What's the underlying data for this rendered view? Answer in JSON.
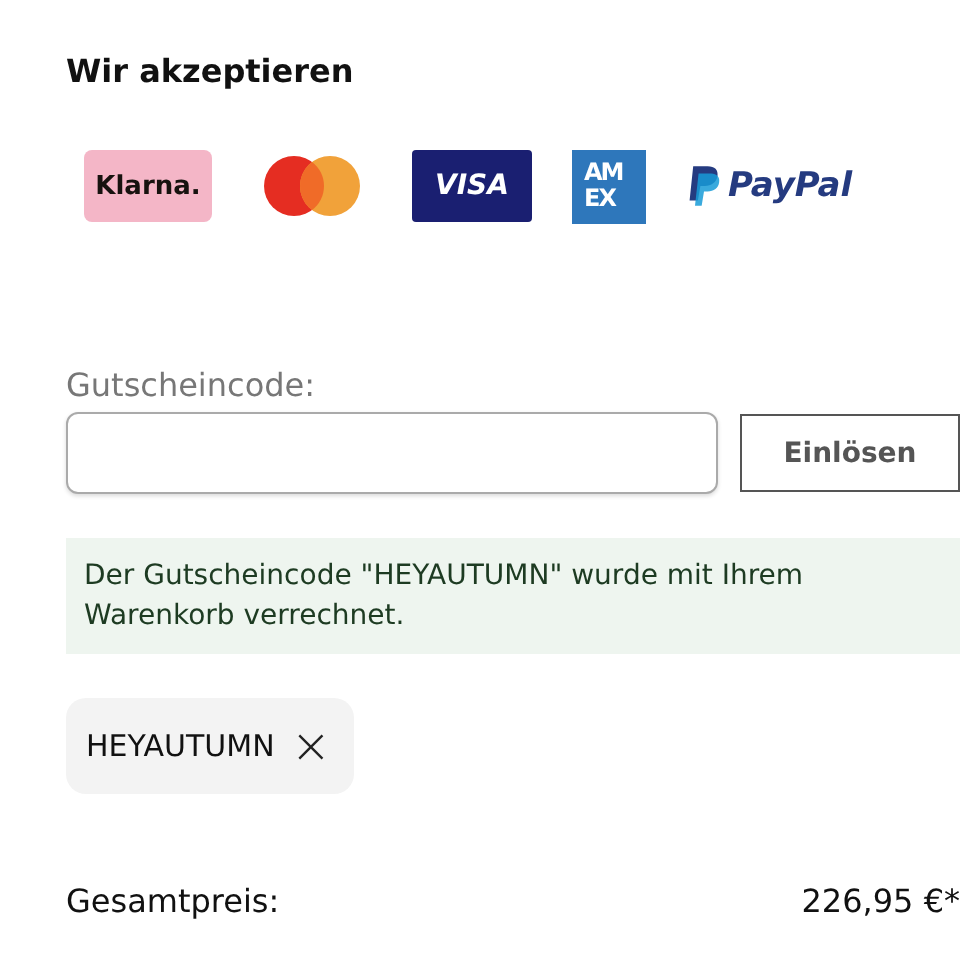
{
  "heading": "Wir akzeptieren",
  "payment_logos": [
    {
      "kind": "klarna",
      "label": "Klarna."
    },
    {
      "kind": "mastercard"
    },
    {
      "kind": "visa",
      "label": "VISA"
    },
    {
      "kind": "amex",
      "lines": [
        "AM",
        "EX"
      ]
    },
    {
      "kind": "paypal",
      "label": "PayPal"
    }
  ],
  "voucher": {
    "label": "Gutscheincode:",
    "button": "Einlösen"
  },
  "message": "Der Gutscheincode \"HEYAUTUMN\" wurde mit Ihrem Warenkorb verrechnet.",
  "applied_codes": [
    {
      "code": "HEYAUTUMN",
      "remove": "×"
    }
  ],
  "total": {
    "label": "Gesamtpreis:",
    "value": "226,95 €*"
  }
}
